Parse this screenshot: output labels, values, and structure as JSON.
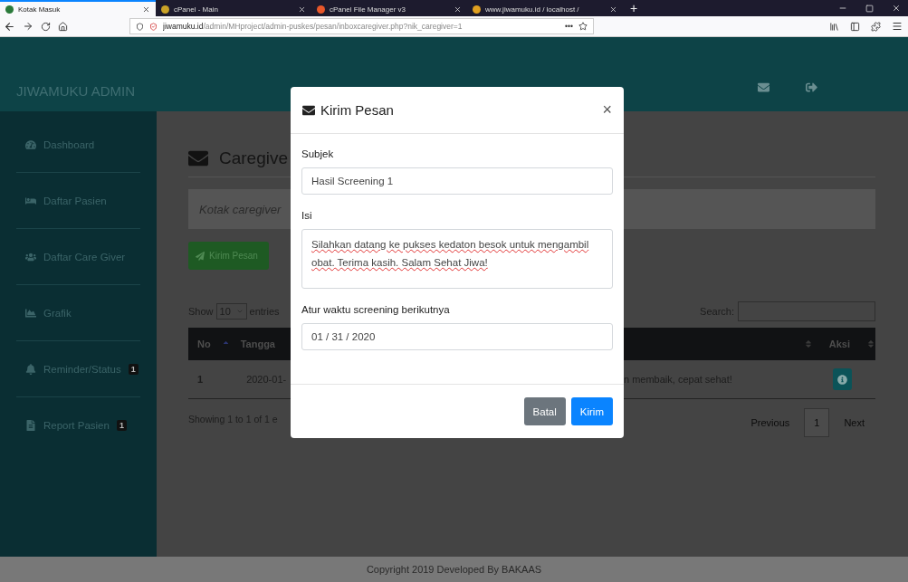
{
  "browser": {
    "tabs": [
      {
        "label": "Kotak Masuk",
        "selected": true
      },
      {
        "label": "cPanel - Main",
        "selected": false
      },
      {
        "label": "cPanel File Manager v3",
        "selected": false
      },
      {
        "label": "www.jiwamuku.id / localhost /",
        "selected": false
      }
    ],
    "new_tab": "+",
    "address": "**jiwamuku.id**/admin/MHproject/admin-puskes/pesan/inboxcaregiver.php?nik_caregiver=1",
    "address_menu": "•••"
  },
  "navbar": {
    "brand": "JIWAMUKU ADMIN"
  },
  "sidebar": {
    "items": [
      {
        "label": "Dashboard"
      },
      {
        "label": "Daftar Pasien"
      },
      {
        "label": "Daftar Care Giver"
      },
      {
        "label": "Grafik"
      },
      {
        "label": "Reminder/Status",
        "badge": "1"
      },
      {
        "label": "Report Pasien",
        "badge": "1"
      }
    ]
  },
  "content": {
    "title": "Caregive",
    "jumbotron": "Kotak caregiver",
    "send_button": "Kirim Pesan",
    "length": {
      "show": "Show",
      "value": "10",
      "entries": "entries"
    },
    "search_label": "Search:",
    "table": {
      "columns_left": [
        "No",
        "Tangga"
      ],
      "columns_right": [
        "Aksi"
      ],
      "rows": [
        {
          "no": "1",
          "date": "2020-01-",
          "message": "n membaik, cepat sehat!"
        }
      ]
    },
    "info": "Showing 1 to 1 of 1 e",
    "pagination": [
      {
        "label": "Previous",
        "selected": false
      },
      {
        "label": "1",
        "selected": true
      },
      {
        "label": "Next",
        "selected": false
      }
    ]
  },
  "footer": "Copyright 2019 Developed By BAKAAS",
  "modal": {
    "title": "Kirim Pesan",
    "close": "×",
    "fields": [
      {
        "kind": "input",
        "label": "Subjek",
        "value": "Hasil Screening 1"
      },
      {
        "kind": "textarea",
        "label": "Isi",
        "value": "Silahkan datang ke pukses kedaton besok untuk mengambil obat. Terima kasih. Salam Sehat Jiwa!"
      },
      {
        "kind": "date",
        "label": "Atur waktu screening berikutnya",
        "value": "01 / 31 / 2020"
      }
    ],
    "buttons": [
      {
        "label": "Batal",
        "kind": "secondary"
      },
      {
        "label": "Kirim",
        "kind": "primary"
      }
    ]
  }
}
